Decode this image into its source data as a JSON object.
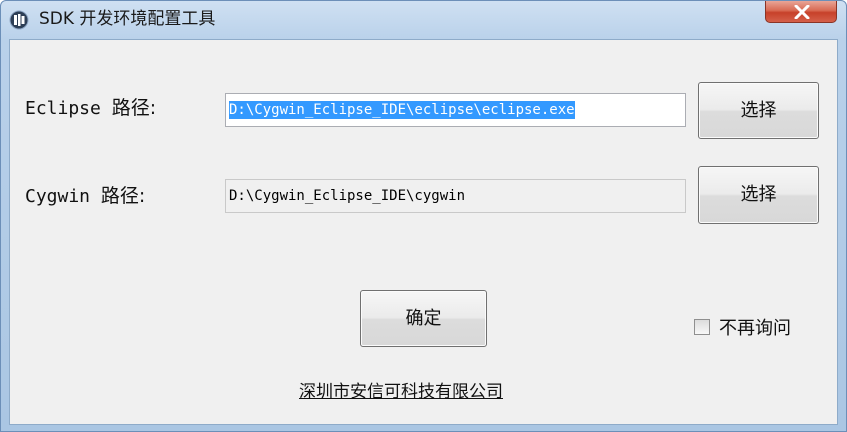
{
  "window": {
    "title": "SDK 开发环境配置工具",
    "close_glyph": "x"
  },
  "eclipse": {
    "label_prefix": "Eclipse",
    "label_suffix": "路径:",
    "path_value": "D:\\Cygwin_Eclipse_IDE\\eclipse\\eclipse.exe",
    "browse_label": "选择"
  },
  "cygwin": {
    "label_prefix": "Cygwin",
    "label_suffix": "路径:",
    "path_value": "D:\\Cygwin_Eclipse_IDE\\cygwin",
    "browse_label": "选择"
  },
  "actions": {
    "ok_label": "确定",
    "dont_ask_label": "不再询问",
    "dont_ask_checked": false
  },
  "footer": {
    "company_link": "深圳市安信可科技有限公司"
  },
  "colors": {
    "selection": "#3399ff",
    "titlebar": "#b9d1ea",
    "close_button": "#c7412a"
  },
  "icons": {
    "app": "app-icon",
    "close": "close-icon",
    "checkbox": "checkbox"
  }
}
